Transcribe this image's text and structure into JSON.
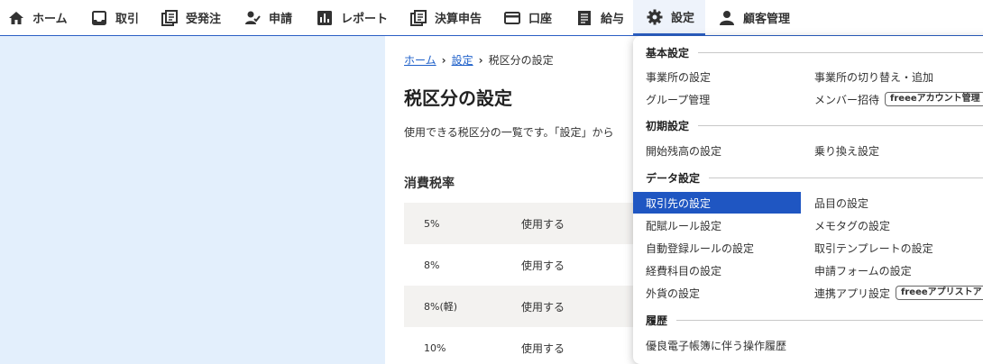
{
  "nav": {
    "items": [
      {
        "label": "ホーム",
        "icon": "home-icon"
      },
      {
        "label": "取引",
        "icon": "inbox-icon"
      },
      {
        "label": "受発注",
        "icon": "documents-icon"
      },
      {
        "label": "申請",
        "icon": "user-check-icon"
      },
      {
        "label": "レポート",
        "icon": "chart-icon"
      },
      {
        "label": "決算申告",
        "icon": "documents-icon"
      },
      {
        "label": "口座",
        "icon": "card-icon"
      },
      {
        "label": "給与",
        "icon": "ledger-icon"
      },
      {
        "label": "設定",
        "icon": "gear-icon"
      },
      {
        "label": "顧客管理",
        "icon": "person-icon"
      }
    ],
    "active_color": "#2b5fc4"
  },
  "breadcrumb": {
    "home": "ホーム",
    "settings": "設定",
    "current": "税区分の設定"
  },
  "page": {
    "title": "税区分の設定",
    "description": "使用できる税区分の一覧です。「設定」から",
    "section_title": "消費税率"
  },
  "rates": [
    {
      "rate": "5%",
      "status": "使用する"
    },
    {
      "rate": "8%",
      "status": "使用する"
    },
    {
      "rate": "8%(軽)",
      "status": "使用する"
    },
    {
      "rate": "10%",
      "status": "使用する"
    }
  ],
  "menu": {
    "basic": {
      "title": "基本設定",
      "office_settings": "事業所の設定",
      "office_switch": "事業所の切り替え・追加",
      "group": "グループ管理",
      "member_invite": "メンバー招待",
      "member_badge": "freeeアカウント管理"
    },
    "initial": {
      "title": "初期設定",
      "opening_balance": "開始残高の設定",
      "migration": "乗り換え設定"
    },
    "data": {
      "title": "データ設定",
      "partners": "取引先の設定",
      "items": "品目の設定",
      "rules": "配賦ルール設定",
      "memo_tags": "メモタグの設定",
      "auto_register": "自動登録ルールの設定",
      "templates": "取引テンプレートの設定",
      "expense_accounts": "経費科目の設定",
      "request_forms": "申請フォームの設定",
      "currency": "外貨の設定",
      "apps": "連携アプリ設定",
      "apps_badge": "freeeアプリストア"
    },
    "history": {
      "title": "履歴",
      "ebook_log": "優良電子帳簿に伴う操作履歴"
    },
    "selected_color": "#1f56c2"
  }
}
